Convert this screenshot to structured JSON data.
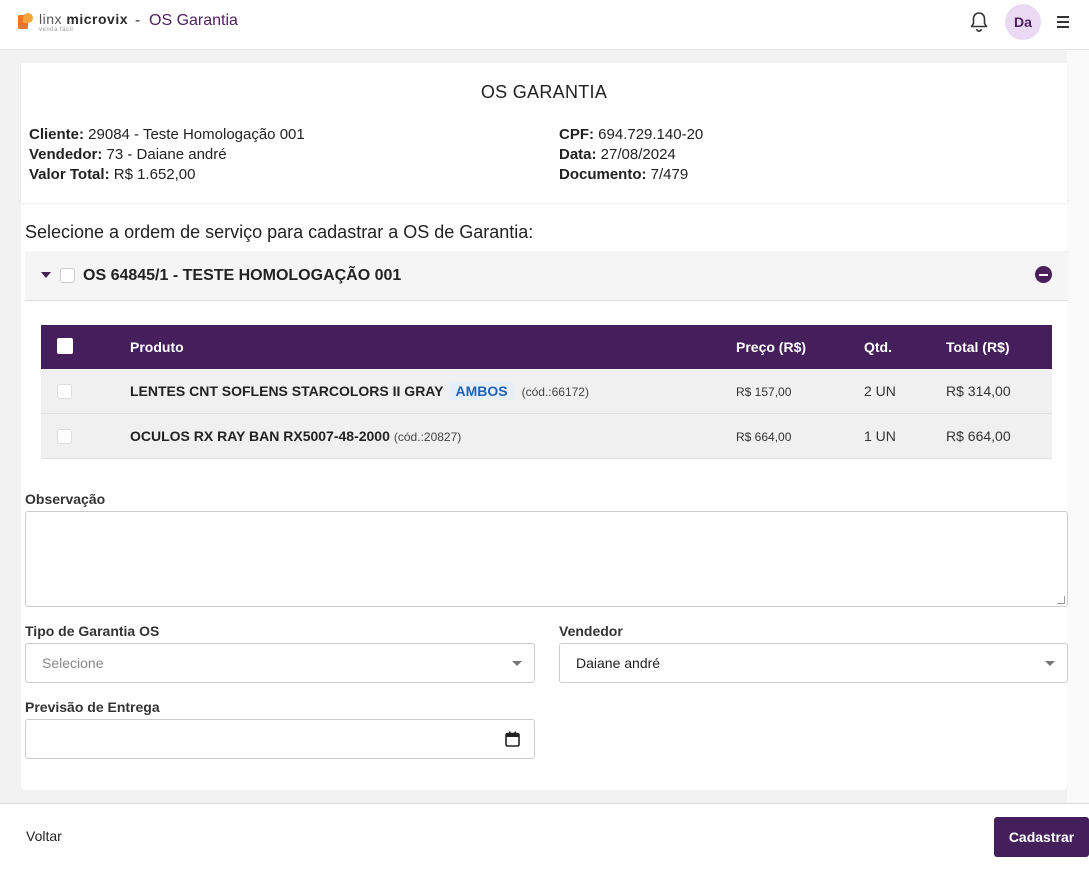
{
  "header": {
    "logo_text_light": "linx",
    "logo_text_bold": "microvix",
    "logo_sub": "venda fácil",
    "separator": "-",
    "title": "OS Garantia",
    "avatar_initials": "Da"
  },
  "info": {
    "title": "OS GARANTIA",
    "cliente_label": "Cliente:",
    "cliente_value": " 29084 - Teste Homologação 001",
    "vendedor_label": "Vendedor:",
    "vendedor_value": " 73 - Daiane andré",
    "valor_label": "Valor Total:",
    "valor_value": " R$ 1.652,00",
    "cpf_label": "CPF:",
    "cpf_value": " 694.729.140-20",
    "data_label": "Data:",
    "data_value": " 27/08/2024",
    "documento_label": "Documento:",
    "documento_value": " 7/479"
  },
  "select_hint": "Selecione a ordem de serviço para cadastrar a OS de Garantia:",
  "os": {
    "label": "OS 64845/1 - TESTE HOMOLOGAÇÃO 001"
  },
  "table": {
    "headers": {
      "produto": "Produto",
      "preco": "Preço (R$)",
      "qtd": "Qtd.",
      "total": "Total (R$)"
    },
    "rows": [
      {
        "name": "LENTES CNT SOFLENS STARCOLORS II GRAY",
        "badge": "AMBOS",
        "code": "(cód.:66172)",
        "preco": "R$ 157,00",
        "qtd": "2 UN",
        "total": "R$ 314,00"
      },
      {
        "name": "OCULOS RX RAY BAN RX5007-48-2000",
        "badge": "",
        "code": "(cód.:20827)",
        "preco": "R$ 664,00",
        "qtd": "1 UN",
        "total": "R$ 664,00"
      }
    ]
  },
  "form": {
    "observacao_label": "Observação",
    "tipo_label": "Tipo de Garantia OS",
    "tipo_placeholder": "Selecione",
    "vendedor_label": "Vendedor",
    "vendedor_value": "Daiane andré",
    "previsao_label": "Previsão de Entrega"
  },
  "footer": {
    "voltar": "Voltar",
    "cadastrar": "Cadastrar"
  },
  "colors": {
    "primary": "#441f5c",
    "badge": "#2160b3"
  }
}
